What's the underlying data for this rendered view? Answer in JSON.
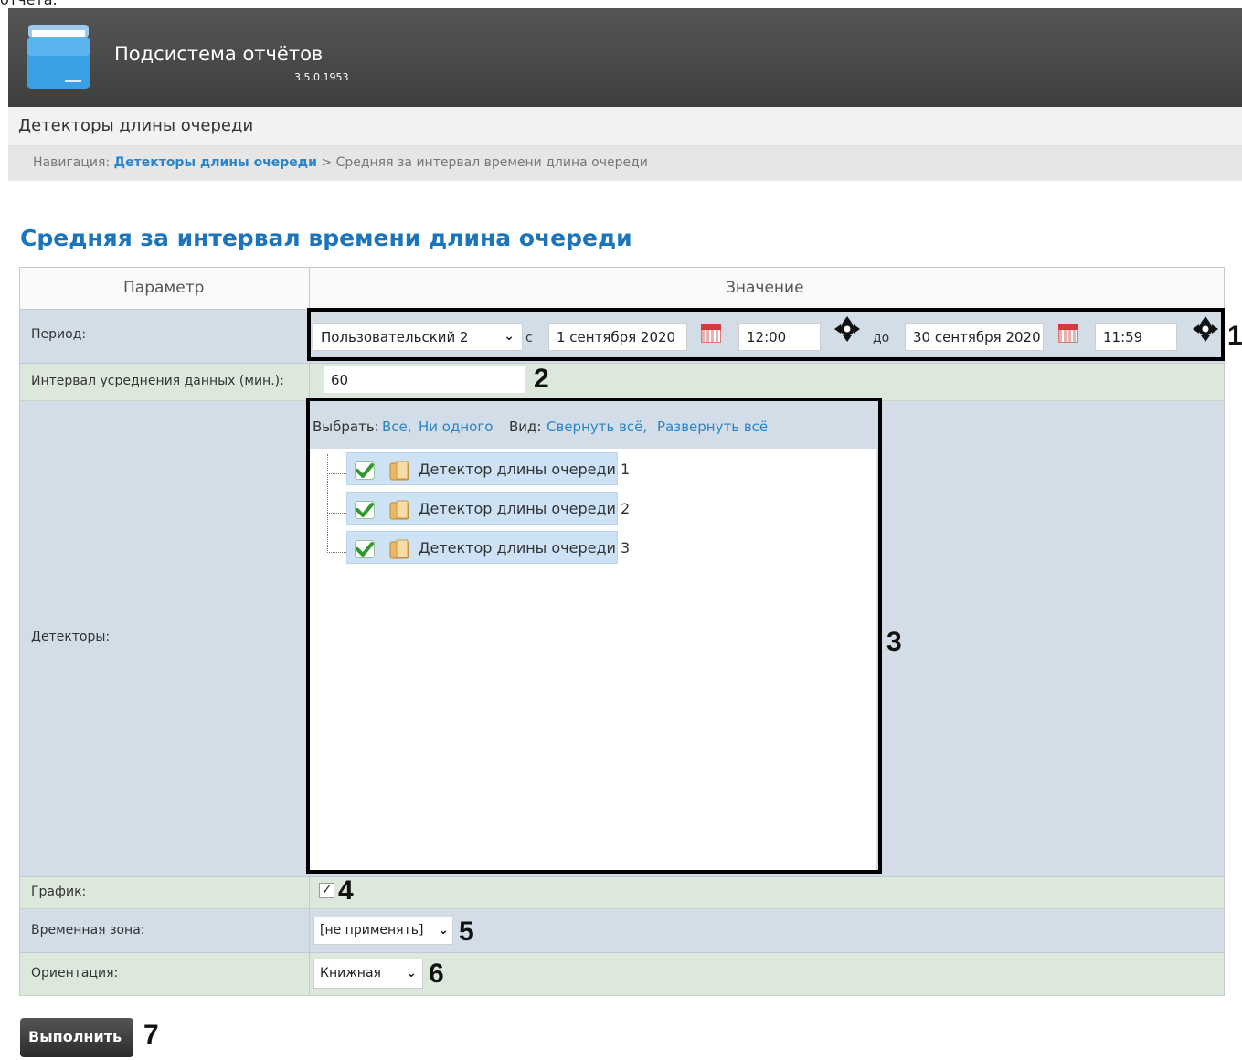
{
  "top_fragment": "отчёта.",
  "header": {
    "title": "Подсистема отчётов",
    "version": "3.5.0.1953"
  },
  "section": {
    "title": "Детекторы длины очереди"
  },
  "breadcrumb": {
    "prefix": "Навигация:",
    "link": "Детекторы длины очереди",
    "separator": ">",
    "current": "Средняя за интервал времени длина очереди"
  },
  "page_title": "Средняя за интервал времени длина очереди",
  "table": {
    "col_param": "Параметр",
    "col_value": "Значение"
  },
  "period": {
    "label": "Период:",
    "preset": "Пользовательский 2",
    "from_label": "с",
    "from_date": "1 сентября 2020",
    "from_time": "12:00",
    "to_label": "до",
    "to_date": "30 сентября 2020",
    "to_time": "11:59"
  },
  "interval": {
    "label": "Интервал усреднения данных (мин.):",
    "value": "60"
  },
  "detectors": {
    "label": "Детекторы:",
    "select_label": "Выбрать:",
    "select_all": "Все,",
    "select_none": "Ни одного",
    "view_label": "Вид:",
    "collapse_all": "Свернуть всё,",
    "expand_all": "Развернуть всё",
    "items": [
      {
        "label": "Детектор длины очереди 1",
        "checked": true
      },
      {
        "label": "Детектор длины очереди 2",
        "checked": true
      },
      {
        "label": "Детектор длины очереди 3",
        "checked": true
      }
    ]
  },
  "chart": {
    "label": "График:",
    "checked": true,
    "check_glyph": "✓"
  },
  "timezone": {
    "label": "Временная зона:",
    "value": "[не применять]"
  },
  "orientation": {
    "label": "Ориентация:",
    "value": "Книжная"
  },
  "run_button": "Выполнить",
  "markers": [
    "1",
    "2",
    "3",
    "4",
    "5",
    "6",
    "7"
  ],
  "icons": {
    "logo": "folder-app-icon",
    "calendar": "calendar-icon",
    "move": "move-icon",
    "checkbox": "green-check-icon",
    "folder": "folder-icon",
    "chevron": "chevron-down-icon"
  }
}
